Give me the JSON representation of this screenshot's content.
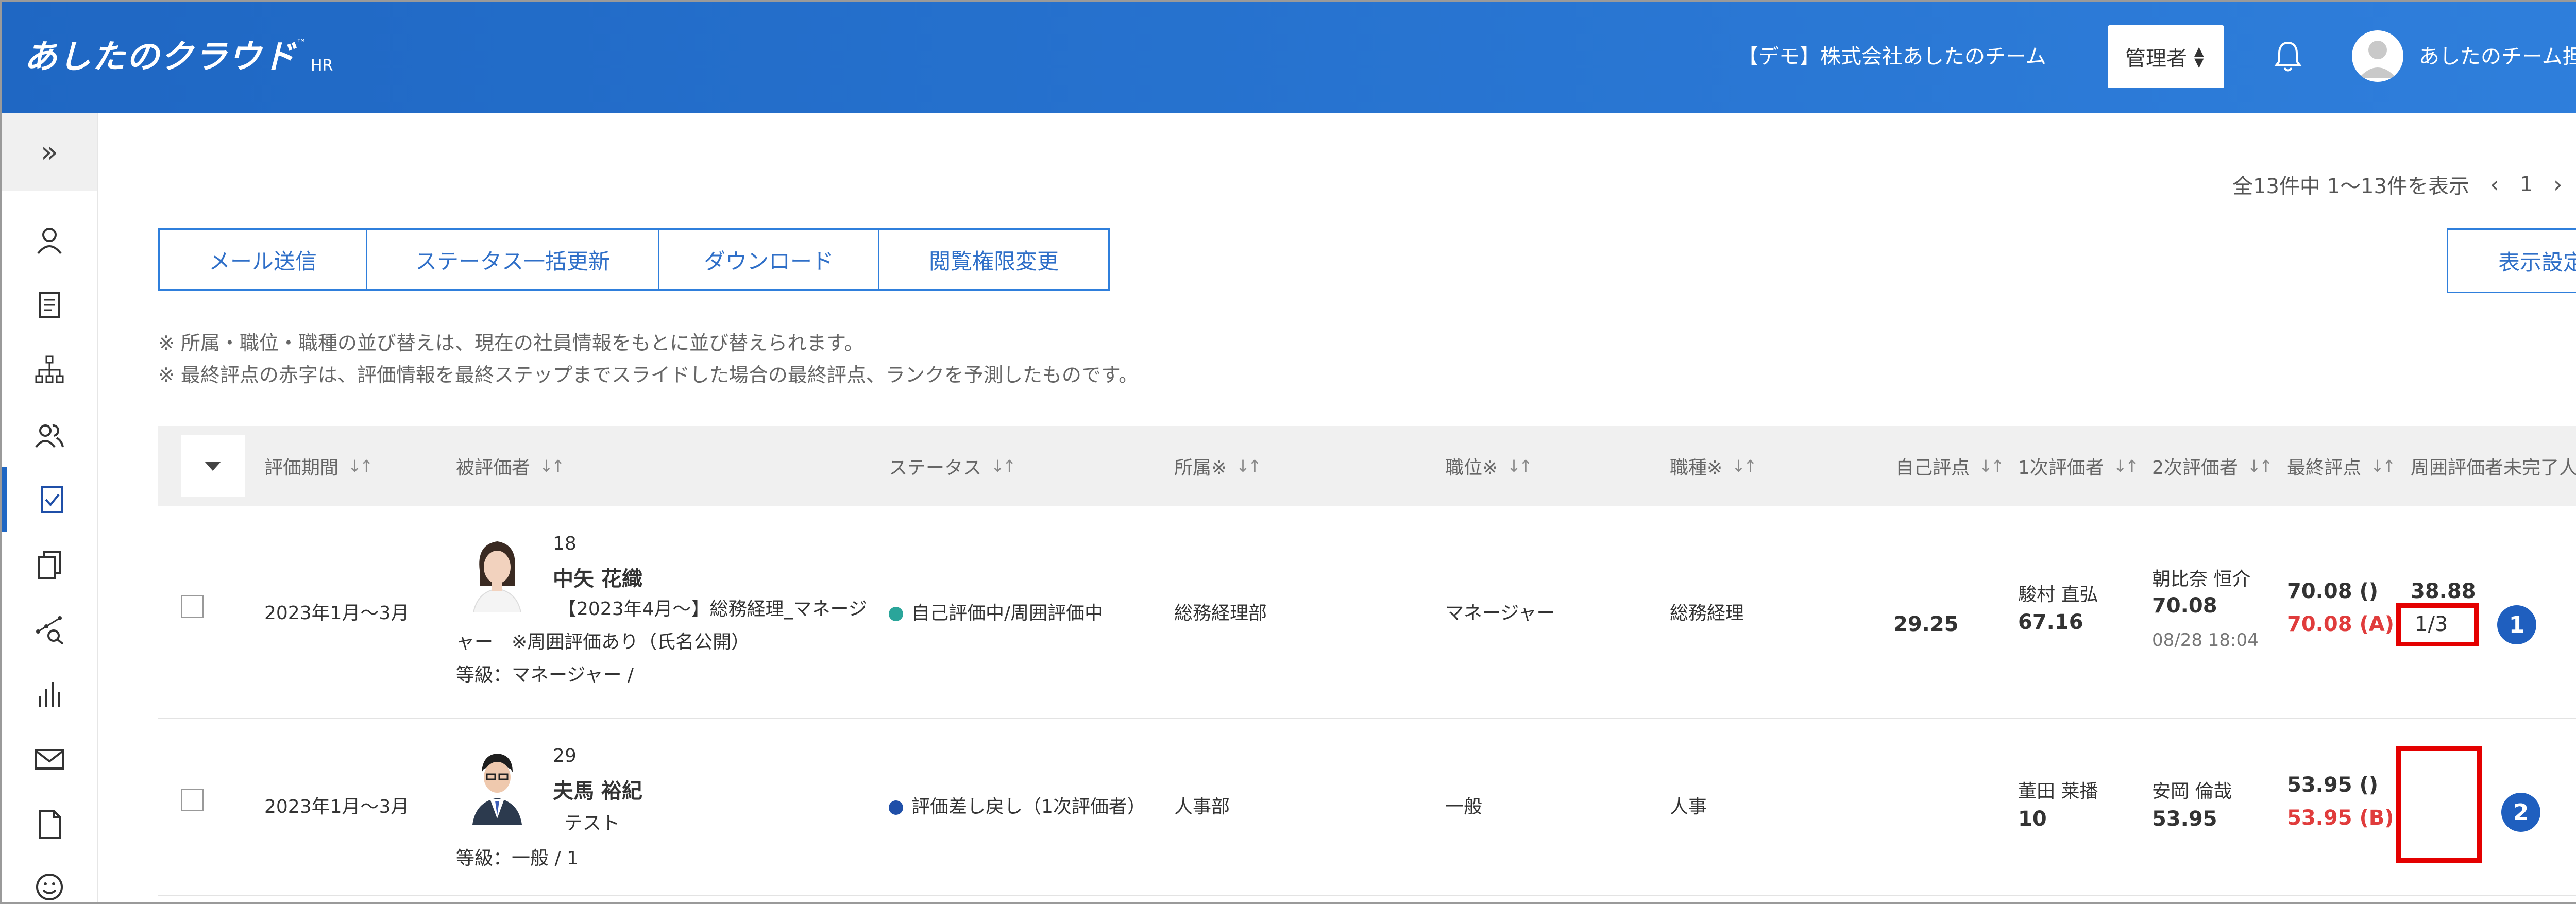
{
  "header": {
    "logo_text": "あしたのクラウド",
    "logo_tm": "™",
    "logo_suffix": "HR",
    "company": "【デモ】株式会社あしたのチーム",
    "role_select": "管理者",
    "user_name": "あしたのチーム担当者",
    "bg_color": "#2a74d3"
  },
  "sidebar": {
    "icons": [
      "expand-icon",
      "user-icon",
      "document-icon",
      "org-chart-icon",
      "users-icon",
      "evaluation-check-icon",
      "copy-icon",
      "analytics-search-icon",
      "bar-chart-icon",
      "mail-icon",
      "file-icon",
      "smile-icon"
    ],
    "active": "evaluation-check-icon"
  },
  "pagination": {
    "summary": "全13件中 1〜13件を表示",
    "prev": "‹",
    "page": "1",
    "next": "›"
  },
  "toolbar": {
    "mail": "メール送信",
    "status_update": "ステータス一括更新",
    "download": "ダウンロード",
    "permission": "閲覧権限変更",
    "view_settings": "表示設定"
  },
  "notes": [
    "※ 所属・職位・職種の並び替えは、現在の社員情報をもとに並び替えられます。",
    "※ 最終評点の赤字は、評価情報を最終ステップまでスライドした場合の最終評点、ランクを予測したものです。"
  ],
  "table": {
    "headers": {
      "period": "評価期間",
      "evaluatee": "被評価者",
      "status": "ステータス",
      "department": "所属※",
      "position": "職位※",
      "job": "職種※",
      "self_score": "自己評点",
      "first_eval": "1次評価者",
      "second_eval": "2次評価者",
      "final_score": "最終評点",
      "peer_incomplete": "周囲評価者未完了人数"
    },
    "sort_symbol": "↓↑",
    "rows": [
      {
        "period": "2023年1月〜3月",
        "id": "18",
        "name": "中矢 花織",
        "title_line1": "【2023年4月〜】総務経理_マネージ",
        "title_line2": "ャー　※周囲評価あり（氏名公開）",
        "grade": "等級：マネージャー /",
        "status": "自己評価中/周囲評価中",
        "status_color": "#2aa59a",
        "department": "総務経理部",
        "position": "マネージャー",
        "job": "総務経理",
        "self_score": "29.25",
        "first_eval_name": "駿村 直弘",
        "first_eval_score": "67.16",
        "second_eval_name": "朝比奈 恒介",
        "second_eval_score": "70.08",
        "second_eval_date": "08/28 18:04",
        "final_score": "70.08 ()",
        "final_predicted": "70.08 (A)",
        "peer_score": "38.88",
        "peer_count": "1/3",
        "badge": "1"
      },
      {
        "period": "2023年1月〜3月",
        "id": "29",
        "name": "夫馬 裕紀",
        "title_line1": "テスト",
        "title_line2": "",
        "grade": "等級：一般 / 1",
        "status": "評価差し戻し（1次評価者）",
        "status_color": "#1f4fa8",
        "department": "人事部",
        "position": "一般",
        "job": "人事",
        "self_score": "",
        "first_eval_name": "董田 莱播",
        "first_eval_score": "10",
        "second_eval_name": "安岡 倫哉",
        "second_eval_score": "53.95",
        "second_eval_date": "",
        "final_score": "53.95 ()",
        "final_predicted": "53.95 (B)",
        "peer_score": "",
        "peer_count": "",
        "badge": "2"
      }
    ]
  },
  "colors": {
    "accent": "#2f7fdc",
    "highlight_box": "#e40000",
    "badge": "#1f5fbf"
  }
}
